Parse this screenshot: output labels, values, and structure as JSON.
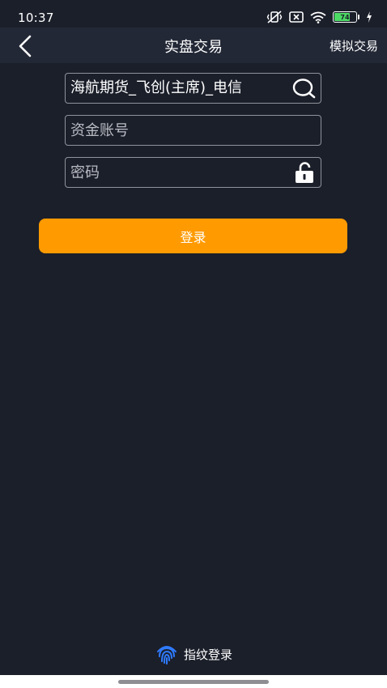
{
  "status_bar": {
    "time": "10:37",
    "battery_level": "74",
    "battery_fraction": 0.74
  },
  "header": {
    "back_icon": "chevron-left-icon",
    "title": "实盘交易",
    "right_action": "模拟交易"
  },
  "form": {
    "broker": {
      "value": "海航期货_飞创(主席)_电信",
      "icon": "search-icon"
    },
    "account": {
      "placeholder": "资金账号",
      "value": ""
    },
    "password": {
      "placeholder": "密码",
      "value": "",
      "icon": "unlock-icon"
    },
    "login_label": "登录"
  },
  "fingerprint": {
    "icon": "fingerprint-icon",
    "label": "指纹登录"
  },
  "colors": {
    "background": "#1b1f2a",
    "header": "#232836",
    "accent": "#ff9a00",
    "fingerprint": "#2f7bff",
    "field_border": "#8f939b"
  }
}
